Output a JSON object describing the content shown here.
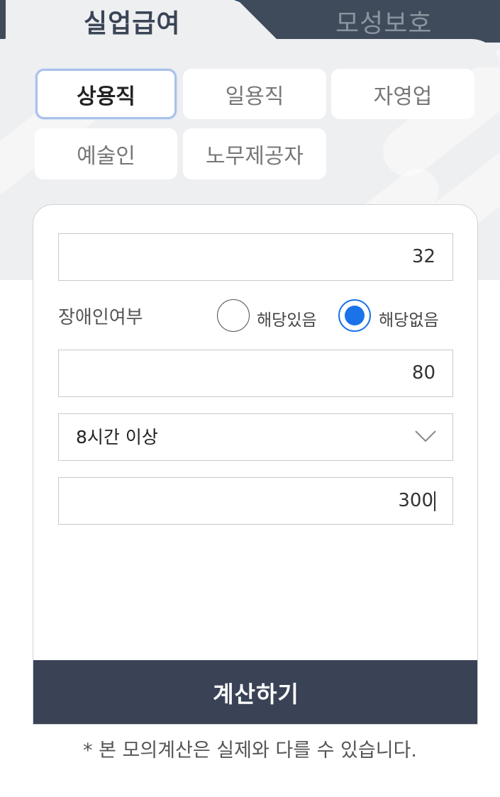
{
  "top_tabs": [
    {
      "label": "실업급여",
      "active": true
    },
    {
      "label": "모성보호",
      "active": false
    }
  ],
  "worker_types": [
    {
      "label": "상용직",
      "selected": true
    },
    {
      "label": "일용직",
      "selected": false
    },
    {
      "label": "자영업",
      "selected": false
    },
    {
      "label": "예술인",
      "selected": false
    },
    {
      "label": "노무제공자",
      "selected": false
    }
  ],
  "form": {
    "age_value": "32",
    "disability": {
      "label": "장애인여부",
      "options": [
        {
          "label": "해당있음",
          "checked": false
        },
        {
          "label": "해당없음",
          "checked": true
        }
      ]
    },
    "second_value": "80",
    "work_hours": {
      "selected": "8시간 이상"
    },
    "third_value": "300",
    "calculate_label": "계산하기"
  },
  "note": "* 본 모의계산은 실제와 다를 수 있습니다.",
  "colors": {
    "accent_blue": "#1a73e8",
    "dark_navy": "#3a4256",
    "tab_dark": "#3f4b5a",
    "selected_border": "#a9c2ea"
  }
}
